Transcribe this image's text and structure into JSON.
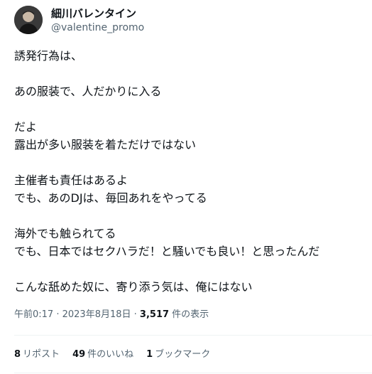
{
  "user": {
    "display_name": "細川バレンタイン",
    "handle": "@valentine_promo"
  },
  "tweet": {
    "lines": [
      "誘発行為は、",
      "あの服装で、人だかりに入る",
      "だよ",
      "露出が多い服装を着ただけではない",
      "主催者も責任はあるよ",
      "でも、あのDJは、毎回あれをやってる",
      "海外でも触られてる",
      "でも、日本ではセクハラだ！と騒いでも良い！と思ったんだ",
      "こんな舐めた奴に、寄り添う気は、俺にはない"
    ]
  },
  "meta": {
    "time": "午前0:17",
    "separator": " · ",
    "date": "2023年8月18日",
    "views_count": "3,517",
    "views_label": " 件の表示"
  },
  "stats": {
    "reposts_count": "8",
    "reposts_label": "リポスト",
    "likes_count": "49",
    "likes_label": "件のいいね",
    "bookmarks_count": "1",
    "bookmarks_label": "ブックマーク"
  },
  "colors": {
    "text": "#0f1419",
    "secondary": "#536471",
    "divider": "#eff3f4"
  }
}
